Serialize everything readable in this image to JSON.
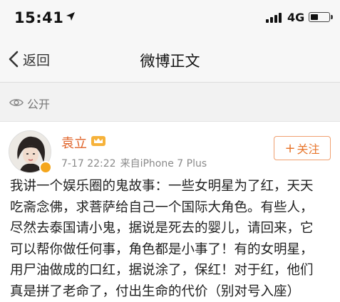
{
  "status_bar": {
    "time": "15:41",
    "network": "4G"
  },
  "nav": {
    "back_label": "返回",
    "title": "微博正文"
  },
  "visibility": {
    "label": "公开"
  },
  "post": {
    "username": "袁立",
    "date": "7-17 22:22",
    "source": "来自iPhone 7 Plus",
    "follow_label": "关注",
    "text_lines": [
      "我讲一个娱乐圈的鬼故事：一些女明星为了红，天天",
      "吃斋念佛，求菩萨给自己一个国际大角色。有些人，",
      "尽然去泰国请小鬼，据说是死去的婴儿，请回来，它",
      "可以帮你做任何事，角色都是小事了！有的女明星，",
      "用尸油做成的口红，据说涂了，保红！对于红，他们",
      "真是拼了老命了，付出生命的代价（别对号入座）"
    ]
  },
  "colors": {
    "accent_orange": "#e8762c",
    "username_orange": "#e0642a",
    "meta_gray": "#8a8a8a"
  },
  "icons": [
    "location-arrow-icon",
    "signal-icon",
    "battery-icon",
    "back-chevron-icon",
    "eye-icon",
    "verified-badge-icon",
    "member-crown-icon"
  ]
}
